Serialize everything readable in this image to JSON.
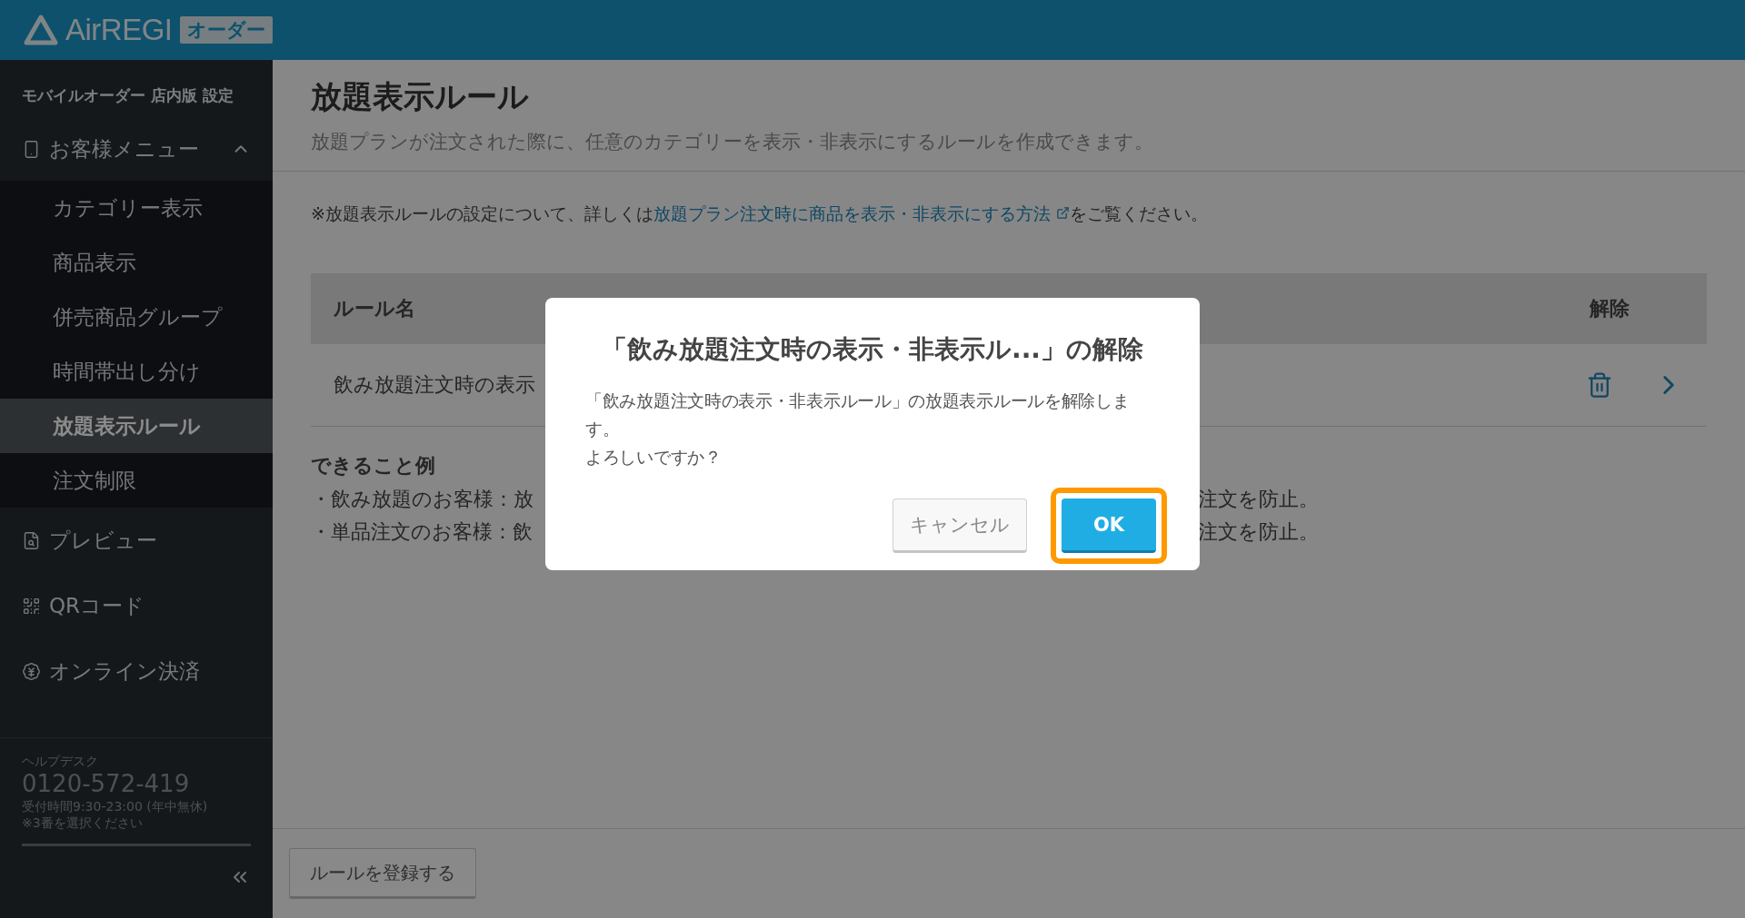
{
  "header": {
    "logo": "AirREGI",
    "badge": "オーダー"
  },
  "sidebar": {
    "heading": "モバイルオーダー 店内版 設定",
    "items": [
      {
        "label": "お客様メニュー",
        "expanded": true,
        "children": [
          {
            "label": "カテゴリー表示",
            "selected": false
          },
          {
            "label": "商品表示",
            "selected": false
          },
          {
            "label": "併売商品グループ",
            "selected": false
          },
          {
            "label": "時間帯出し分け",
            "selected": false
          },
          {
            "label": "放題表示ルール",
            "selected": true
          },
          {
            "label": "注文制限",
            "selected": false
          }
        ]
      },
      {
        "label": "プレビュー"
      },
      {
        "label": "QRコード"
      },
      {
        "label": "オンライン決済"
      }
    ],
    "help": {
      "title": "ヘルプデスク",
      "phone": "0120-572-419",
      "hours": "受付時間9:30-23:00 (年中無休)",
      "note": "※3番を選択ください"
    }
  },
  "page": {
    "title": "放題表示ルール",
    "subtitle": "放題プランが注文された際に、任意のカテゴリーを表示・非表示にするルールを作成できます。",
    "note_before": "※放題表示ルールの設定について、詳しくは",
    "note_link": "放題プラン注文時に商品を表示・非表示にする方法",
    "note_after": "をご覧ください。"
  },
  "table": {
    "columns": [
      "ルール名",
      "解除"
    ],
    "rows": [
      {
        "name": "飲み放題注文時の表示"
      }
    ]
  },
  "examples": {
    "title": "できること例",
    "items": [
      {
        "left": "・飲み放題のお客様：放",
        "right": "注文を防止。"
      },
      {
        "left": "・単品注文のお客様：飲",
        "right": "注文を防止。"
      }
    ]
  },
  "footer": {
    "button": "ルールを登録する"
  },
  "dialog": {
    "title": "「飲み放題注文時の表示・非表示ル...」の解除",
    "message": [
      "「飲み放題注文時の表示・非表示ルール」の放題表示ルールを解除します。",
      "よろしいですか？"
    ],
    "buttons": [
      {
        "label": "キャンセル",
        "kind": "secondary",
        "highlighted": false
      },
      {
        "label": "OK",
        "kind": "primary",
        "highlighted": true
      }
    ]
  }
}
